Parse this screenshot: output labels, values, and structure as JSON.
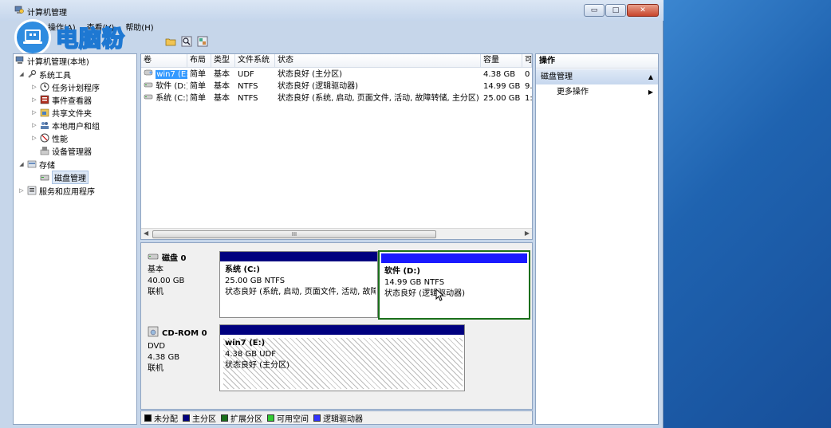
{
  "window": {
    "title": "计算机管理",
    "controls": {
      "minimize": "▭",
      "maximize": "□",
      "close": "✕"
    }
  },
  "menu": [
    {
      "label": "操作(A)"
    },
    {
      "label": "查看(V)"
    },
    {
      "label": "帮助(H)"
    }
  ],
  "watermark": {
    "text": "电脑粉"
  },
  "tree": {
    "root": "计算机管理(本地)",
    "system_tools": "系统工具",
    "task_scheduler": "任务计划程序",
    "event_viewer": "事件查看器",
    "shared_folders": "共享文件夹",
    "local_users": "本地用户和组",
    "performance": "性能",
    "device_manager": "设备管理器",
    "storage": "存储",
    "disk_management": "磁盘管理",
    "services_apps": "服务和应用程序"
  },
  "volume_list": {
    "columns": [
      "卷",
      "布局",
      "类型",
      "文件系统",
      "状态",
      "容量",
      "可"
    ],
    "rows": [
      {
        "volume": "win7 (E:)",
        "layout": "简单",
        "type": "基本",
        "fs": "UDF",
        "status": "状态良好 (主分区)",
        "capacity": "4.38 GB",
        "free": "0"
      },
      {
        "volume": "软件 (D:)",
        "layout": "简单",
        "type": "基本",
        "fs": "NTFS",
        "status": "状态良好 (逻辑驱动器)",
        "capacity": "14.99 GB",
        "free": "9."
      },
      {
        "volume": "系统 (C:)",
        "layout": "简单",
        "type": "基本",
        "fs": "NTFS",
        "status": "状态良好 (系统, 启动, 页面文件, 活动, 故障转储, 主分区)",
        "capacity": "25.00 GB",
        "free": "1:"
      }
    ],
    "scroll_thumb": "III"
  },
  "disks": {
    "disk0": {
      "name": "磁盘 0",
      "type": "基本",
      "size": "40.00 GB",
      "state": "联机",
      "partitions": [
        {
          "name": "系统  (C:)",
          "size": "25.00 GB NTFS",
          "status": "状态良好 (系统, 启动, 页面文件, 活动, 故障"
        },
        {
          "name": "软件  (D:)",
          "size": "14.99 GB NTFS",
          "status": "状态良好 (逻辑驱动器)"
        }
      ]
    },
    "cdrom0": {
      "name": "CD-ROM 0",
      "type": "DVD",
      "size": "4.38 GB",
      "state": "联机",
      "partitions": [
        {
          "name": "win7  (E:)",
          "size": "4.38 GB UDF",
          "status": "状态良好 (主分区)"
        }
      ]
    }
  },
  "legend": [
    {
      "label": "未分配",
      "color": "#000000"
    },
    {
      "label": "主分区",
      "color": "#00007f"
    },
    {
      "label": "扩展分区",
      "color": "#1a6f1a"
    },
    {
      "label": "可用空间",
      "color": "#33cc33"
    },
    {
      "label": "逻辑驱动器",
      "color": "#3333ff"
    }
  ],
  "actions": {
    "header": "操作",
    "section": "磁盘管理",
    "more": "更多操作"
  }
}
